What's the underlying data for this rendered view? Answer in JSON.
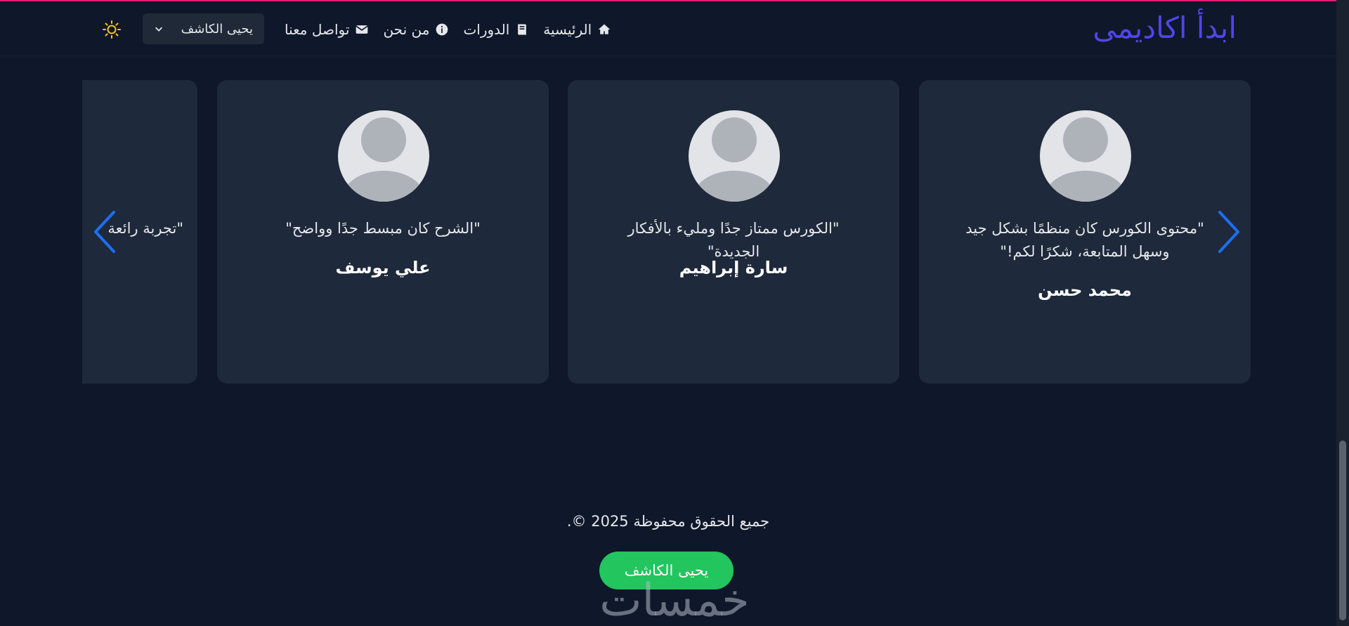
{
  "header": {
    "brand": "ابدأ اكاديمى",
    "nav": [
      {
        "label": "الرئيسية",
        "icon": "home-icon"
      },
      {
        "label": "الدورات",
        "icon": "book-icon"
      },
      {
        "label": "من نحن",
        "icon": "info-icon"
      },
      {
        "label": "تواصل معنا",
        "icon": "envelope-icon"
      }
    ],
    "user_menu": {
      "selected": "يحيى الكاشف",
      "icon": "chevron-down-icon"
    },
    "theme_toggle": {
      "icon": "sun-icon"
    }
  },
  "testimonials": [
    {
      "quote": "\"محتوى الكورس كان منظمًا بشكل جيد وسهل المتابعة، شكرًا لكم!\"",
      "name": "محمد حسن"
    },
    {
      "quote": "\"الكورس ممتاز جدًا ومليء بالأفكار الجديدة\"",
      "name": "سارة إبراهيم"
    },
    {
      "quote": "\"الشرح كان مبسط جدًا وواضح\"",
      "name": "علي يوسف"
    },
    {
      "quote": "\"تجربة رائعة",
      "name": ""
    }
  ],
  "carousel": {
    "next_icon": "chevron-right-icon",
    "prev_icon": "chevron-left-icon"
  },
  "footer": {
    "copyright": "جميع الحقوق محفوظة 2025 ©.",
    "author_button": "يحيى الكاشف",
    "watermark": "خمسات"
  },
  "colors": {
    "background": "#0f172a",
    "card": "#1e293b",
    "brand": "#4f46e5",
    "accent_green": "#22c55e",
    "arrow": "#1d6ff2",
    "sun": "#f5c518"
  }
}
